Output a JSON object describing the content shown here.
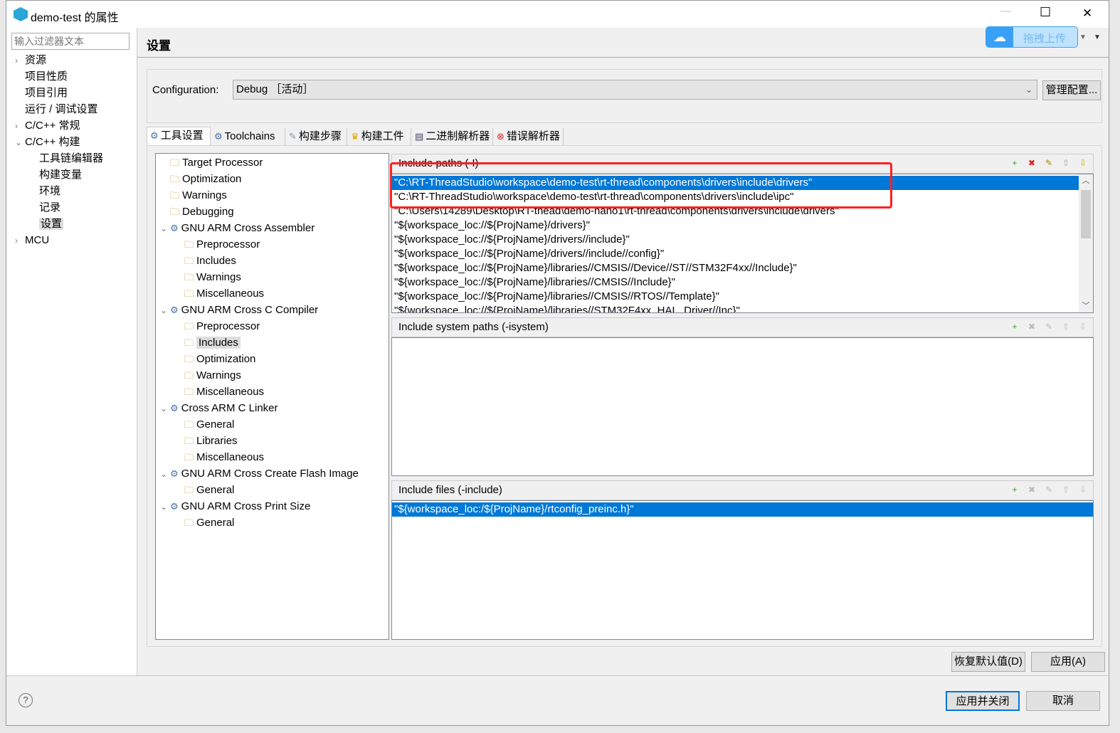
{
  "window": {
    "title": "demo-test 的属性",
    "minimize": "—",
    "maximize": "☐",
    "close": "✕"
  },
  "filter": {
    "placeholder": "输入过滤器文本"
  },
  "nav": [
    {
      "label": "资源",
      "level": 0,
      "chev": "›"
    },
    {
      "label": "项目性质",
      "level": 0,
      "chev": ""
    },
    {
      "label": "项目引用",
      "level": 0,
      "chev": ""
    },
    {
      "label": "运行 / 调试设置",
      "level": 0,
      "chev": ""
    },
    {
      "label": "C/C++ 常规",
      "level": 0,
      "chev": "›"
    },
    {
      "label": "C/C++ 构建",
      "level": 0,
      "chev": "⌄"
    },
    {
      "label": "工具链编辑器",
      "level": 1,
      "chev": ""
    },
    {
      "label": "构建变量",
      "level": 1,
      "chev": ""
    },
    {
      "label": "环境",
      "level": 1,
      "chev": ""
    },
    {
      "label": "记录",
      "level": 1,
      "chev": ""
    },
    {
      "label": "设置",
      "level": 1,
      "chev": "",
      "selected": true
    },
    {
      "label": "MCU",
      "level": 0,
      "chev": "›"
    }
  ],
  "page": {
    "title": "设置"
  },
  "upload": {
    "label": "拖拽上传"
  },
  "config": {
    "label": "Configuration:",
    "value": "Debug ［活动］",
    "manage": "管理配置..."
  },
  "tabs": [
    {
      "label": "工具设置",
      "icon": "⚙"
    },
    {
      "label": "Toolchains",
      "icon": "⚙"
    },
    {
      "label": "构建步骤",
      "icon": "✎"
    },
    {
      "label": "构建工件",
      "icon": "♛"
    },
    {
      "label": "二进制解析器",
      "icon": "▤"
    },
    {
      "label": "错误解析器",
      "icon": "⊗"
    }
  ],
  "tooltree": [
    {
      "label": "Target Processor",
      "level": 0
    },
    {
      "label": "Optimization",
      "level": 0
    },
    {
      "label": "Warnings",
      "level": 0
    },
    {
      "label": "Debugging",
      "level": 0
    },
    {
      "label": "GNU ARM Cross Assembler",
      "level": 0,
      "chev": "⌄"
    },
    {
      "label": "Preprocessor",
      "level": 1
    },
    {
      "label": "Includes",
      "level": 1
    },
    {
      "label": "Warnings",
      "level": 1
    },
    {
      "label": "Miscellaneous",
      "level": 1
    },
    {
      "label": "GNU ARM Cross C Compiler",
      "level": 0,
      "chev": "⌄"
    },
    {
      "label": "Preprocessor",
      "level": 1
    },
    {
      "label": "Includes",
      "level": 1,
      "selected": true
    },
    {
      "label": "Optimization",
      "level": 1
    },
    {
      "label": "Warnings",
      "level": 1
    },
    {
      "label": "Miscellaneous",
      "level": 1
    },
    {
      "label": "Cross ARM C Linker",
      "level": 0,
      "chev": "⌄"
    },
    {
      "label": "General",
      "level": 1
    },
    {
      "label": "Libraries",
      "level": 1
    },
    {
      "label": "Miscellaneous",
      "level": 1
    },
    {
      "label": "GNU ARM Cross Create Flash Image",
      "level": 0,
      "chev": "⌄"
    },
    {
      "label": "General",
      "level": 1
    },
    {
      "label": "GNU ARM Cross Print Size",
      "level": 0,
      "chev": "⌄"
    },
    {
      "label": "General",
      "level": 1
    }
  ],
  "include_paths": {
    "title": "Include paths (-I)",
    "items": [
      "\"C:\\RT-ThreadStudio\\workspace\\demo-test\\rt-thread\\components\\drivers\\include\\drivers\"",
      "\"C:\\RT-ThreadStudio\\workspace\\demo-test\\rt-thread\\components\\drivers\\include\\ipc\"",
      "\"C:\\Users\\14289\\Desktop\\RT-thead\\demo-nano1\\rt-thread\\components\\drivers\\include\\drivers\"",
      "\"${workspace_loc://${ProjName}/drivers}\"",
      "\"${workspace_loc://${ProjName}/drivers//include}\"",
      "\"${workspace_loc://${ProjName}/drivers//include//config}\"",
      "\"${workspace_loc://${ProjName}/libraries//CMSIS//Device//ST//STM32F4xx//Include}\"",
      "\"${workspace_loc://${ProjName}/libraries//CMSIS//Include}\"",
      "\"${workspace_loc://${ProjName}/libraries//CMSIS//RTOS//Template}\"",
      "\"${workspace_loc://${ProjName}/libraries//STM32F4xx_HAL_Driver//Inc}\""
    ]
  },
  "system_paths": {
    "title": "Include system paths (-isystem)"
  },
  "include_files": {
    "title": "Include files (-include)",
    "items": [
      "\"${workspace_loc:/${ProjName}/rtconfig_preinc.h}\""
    ]
  },
  "buttons": {
    "restore": "恢复默认值(D)",
    "apply": "应用(A)",
    "apply_close": "应用并关闭",
    "cancel": "取消",
    "help": "?"
  },
  "colors": {
    "selection": "#0078d7",
    "highlight_box": "#ff2020",
    "upload": "#3aa0f5"
  }
}
